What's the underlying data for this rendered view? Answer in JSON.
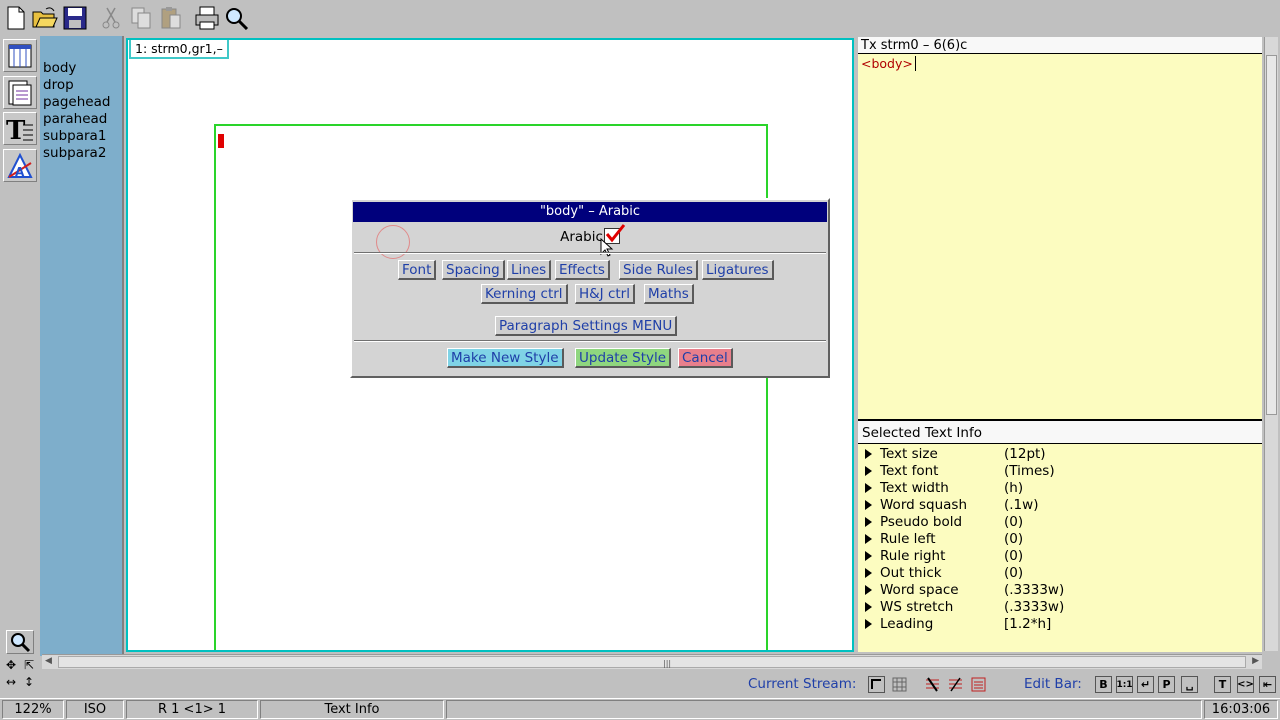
{
  "toolbar": {
    "buttons": [
      "new-file",
      "open-folder",
      "save-disk",
      "cut",
      "copy",
      "paste",
      "print",
      "zoom"
    ]
  },
  "style_list": {
    "items": [
      "body",
      "drop",
      "pagehead",
      "parahead",
      "subpara1",
      "subpara2"
    ]
  },
  "document": {
    "tab_label": "1: strm0,gr1,–"
  },
  "dialog": {
    "title": "\"body\" – Arabic",
    "arabic_label": "Arabic",
    "arabic_checked": true,
    "buttons_row1": [
      "Font",
      "Spacing",
      "Lines",
      "Effects",
      "Side Rules",
      "Ligatures"
    ],
    "buttons_row2": [
      "Kerning ctrl",
      "H&J ctrl",
      "Maths"
    ],
    "paragraph_menu": "Paragraph Settings MENU",
    "make_new_style": "Make New Style",
    "update_style": "Update Style",
    "cancel": "Cancel"
  },
  "right_panel": {
    "header": "Tx strm0 – 6(6)c",
    "editor_text": "<body>",
    "info_title": "Selected Text Info",
    "info_rows": [
      {
        "key": "Text size",
        "value": "(12pt)"
      },
      {
        "key": "Text font",
        "value": "(Times)"
      },
      {
        "key": "Text width",
        "value": "(h)"
      },
      {
        "key": "Word squash",
        "value": "(.1w)"
      },
      {
        "key": "Pseudo bold",
        "value": "(0)"
      },
      {
        "key": "Rule left",
        "value": "(0)"
      },
      {
        "key": "Rule right",
        "value": "(0)"
      },
      {
        "key": "Out thick",
        "value": "(0)"
      },
      {
        "key": "Word space",
        "value": "(.3333w)"
      },
      {
        "key": "WS stretch",
        "value": "(.3333w)"
      },
      {
        "key": "Leading",
        "value": "[1.2*h]"
      }
    ]
  },
  "stream_bar": {
    "current_stream_label": "Current Stream:",
    "edit_bar_label": "Edit Bar:",
    "edit_icons": [
      "B",
      "1:1",
      "↵",
      "P",
      "␣",
      "T",
      "<>",
      "⇤"
    ]
  },
  "status_bar": {
    "zoom": "122%",
    "encoding": "ISO",
    "position": "R 1 <1> 1",
    "mode": "Text Info",
    "message": "",
    "time": "16:03:06"
  },
  "colors": {
    "style_list_bg": "#7eaecb",
    "dialog_title_bg": "#00007c",
    "editor_bg": "#fcfcc0",
    "page_border": "#2ad42a",
    "button_text": "#1f3fa8"
  }
}
